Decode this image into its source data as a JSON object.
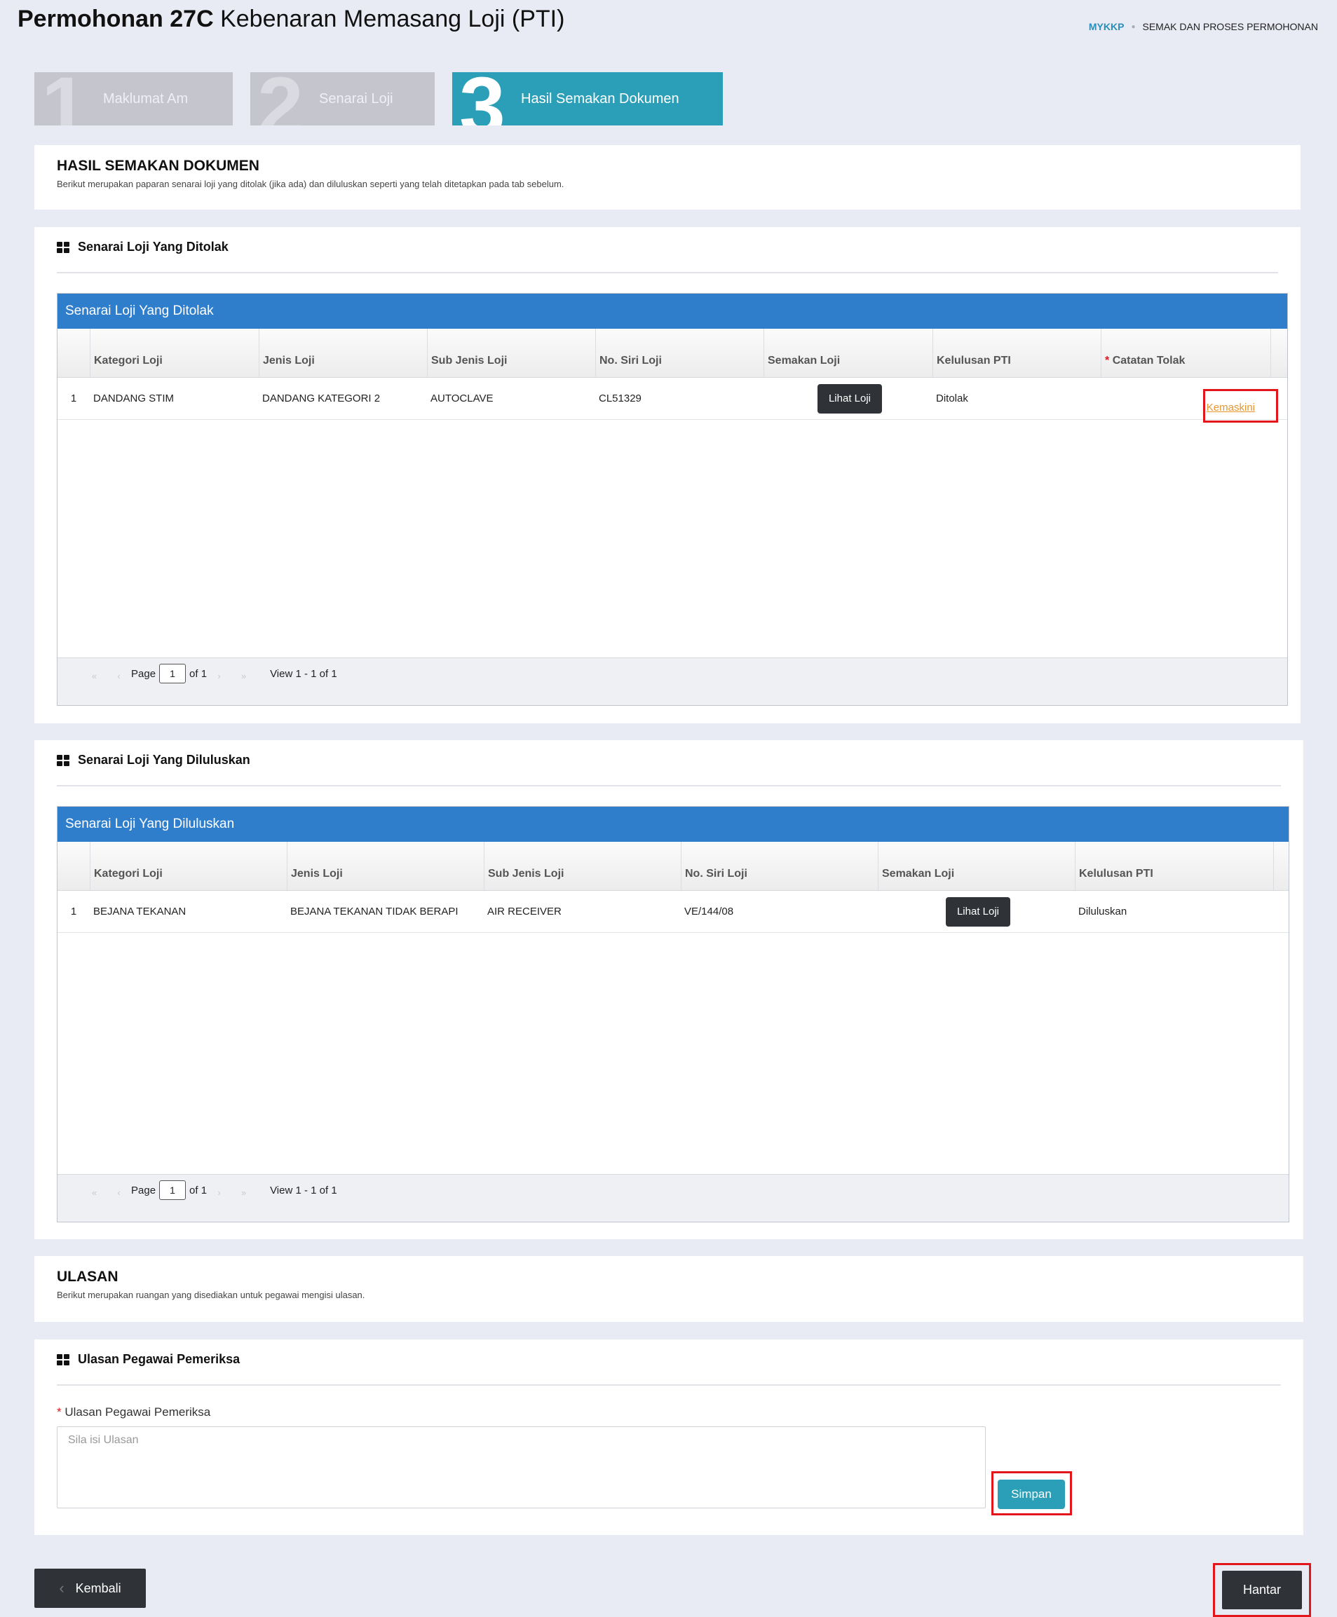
{
  "header": {
    "title_bold": "Permohonan 27C",
    "title_rest": "Kebenaran Memasang Loji (PTI)",
    "breadcrumb": [
      "MYKKP",
      "SEMAK DAN PROSES PERMOHONAN"
    ]
  },
  "steps": [
    {
      "num": "1",
      "label": "Maklumat Am",
      "state": "inactive"
    },
    {
      "num": "2",
      "label": "Senarai Loji",
      "state": "inactive"
    },
    {
      "num": "3",
      "label": "Hasil Semakan Dokumen",
      "state": "active"
    }
  ],
  "hasil": {
    "title": "HASIL SEMAKAN DOKUMEN",
    "subtitle": "Berikut merupakan paparan senarai loji yang ditolak (jika ada) dan diluluskan seperti yang telah ditetapkan pada tab sebelum."
  },
  "ditolak": {
    "card_title": "Senarai Loji Yang Ditolak",
    "table_caption": "Senarai Loji Yang Ditolak",
    "columns": [
      "Kategori Loji",
      "Jenis Loji",
      "Sub Jenis Loji",
      "No. Siri Loji",
      "Semakan Loji",
      "Kelulusan PTI",
      "Catatan Tolak"
    ],
    "rows": [
      {
        "no": "1",
        "kategori": "DANDANG STIM",
        "jenis": "DANDANG KATEGORI 2",
        "sub_jenis": "AUTOCLAVE",
        "no_siri": "CL51329",
        "semakan_button": "Lihat Loji",
        "kelulusan": "Ditolak",
        "catatan_link": "Kemaskini"
      }
    ],
    "pager": {
      "page_label": "Page",
      "page_value": "1",
      "of_label": "of 1",
      "view_label": "View 1 - 1 of 1"
    }
  },
  "diluluskan": {
    "card_title": "Senarai Loji Yang Diluluskan",
    "table_caption": "Senarai Loji Yang Diluluskan",
    "columns": [
      "Kategori Loji",
      "Jenis Loji",
      "Sub Jenis Loji",
      "No. Siri Loji",
      "Semakan Loji",
      "Kelulusan PTI"
    ],
    "rows": [
      {
        "no": "1",
        "kategori": "BEJANA TEKANAN",
        "jenis": "BEJANA TEKANAN TIDAK BERAPI",
        "sub_jenis": "AIR RECEIVER",
        "no_siri": "VE/144/08",
        "semakan_button": "Lihat Loji",
        "kelulusan": "Diluluskan"
      }
    ],
    "pager": {
      "page_label": "Page",
      "page_value": "1",
      "of_label": "of 1",
      "view_label": "View 1 - 1 of 1"
    }
  },
  "ulasan": {
    "title": "ULASAN",
    "subtitle": "Berikut merupakan ruangan yang disediakan untuk pegawai mengisi ulasan.",
    "card_title": "Ulasan Pegawai Pemeriksa",
    "field_label": "Ulasan Pegawai Pemeriksa",
    "required_mark": "*",
    "placeholder": "Sila isi Ulasan",
    "save_button": "Simpan"
  },
  "footer": {
    "back_button": "Kembali",
    "submit_button": "Hantar"
  },
  "colors": {
    "accent_teal": "#2b9fb7",
    "table_caption_blue": "#2f7ecb",
    "highlight_red": "#e3161b",
    "link_orange": "#e8962e",
    "dark_button": "#2f3236"
  },
  "icons": {
    "section_icon": "grid-icon",
    "back_icon": "chevron-left-icon"
  }
}
